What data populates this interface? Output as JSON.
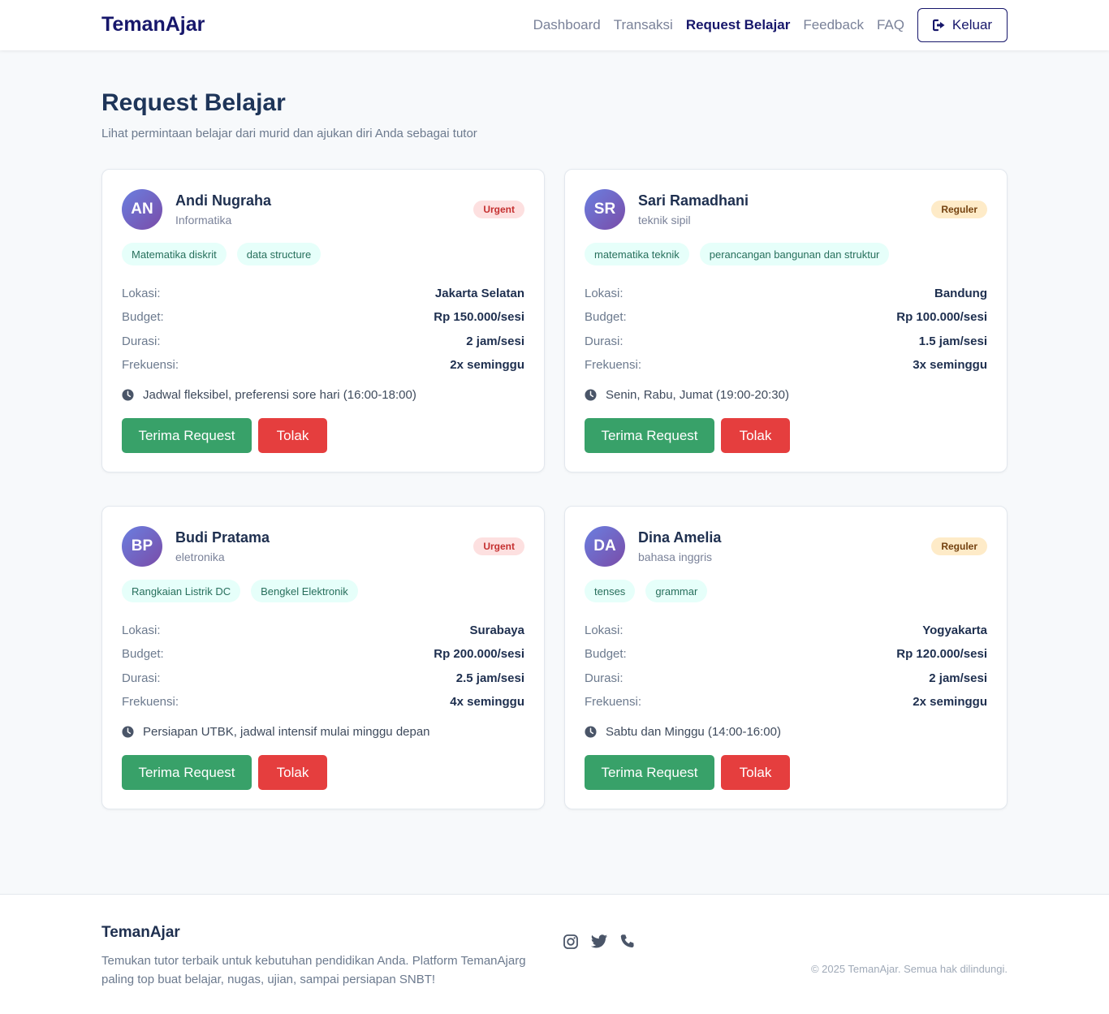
{
  "nav": {
    "brand": "TemanAjar",
    "links": [
      "Dashboard",
      "Transaksi",
      "Request Belajar",
      "Feedback",
      "FAQ"
    ],
    "logout": "Keluar"
  },
  "header": {
    "title": "Request Belajar",
    "subtitle": "Lihat permintaan belajar dari murid dan ajukan diri Anda sebagai tutor"
  },
  "labels": {
    "lokasi": "Lokasi:",
    "budget": "Budget:",
    "durasi": "Durasi:",
    "frekuensi": "Frekuensi:",
    "accept": "Terima Request",
    "reject": "Tolak"
  },
  "requests": [
    {
      "initials": "AN",
      "name": "Andi Nugraha",
      "major": "Informatika",
      "priority": "Urgent",
      "tags": [
        "Matematika diskrit",
        "data structure"
      ],
      "lokasi": "Jakarta Selatan",
      "budget": "Rp 150.000/sesi",
      "durasi": "2 jam/sesi",
      "frekuensi": "2x seminggu",
      "note": "Jadwal fleksibel, preferensi sore hari (16:00-18:00)"
    },
    {
      "initials": "SR",
      "name": "Sari Ramadhani",
      "major": "teknik sipil",
      "priority": "Reguler",
      "tags": [
        "matematika teknik",
        "perancangan bangunan dan struktur"
      ],
      "lokasi": "Bandung",
      "budget": "Rp 100.000/sesi",
      "durasi": "1.5 jam/sesi",
      "frekuensi": "3x seminggu",
      "note": "Senin, Rabu, Jumat (19:00-20:30)"
    },
    {
      "initials": "BP",
      "name": "Budi Pratama",
      "major": "eletronika",
      "priority": "Urgent",
      "tags": [
        "Rangkaian Listrik DC",
        "Bengkel Elektronik"
      ],
      "lokasi": "Surabaya",
      "budget": "Rp 200.000/sesi",
      "durasi": "2.5 jam/sesi",
      "frekuensi": "4x seminggu",
      "note": "Persiapan UTBK, jadwal intensif mulai minggu depan"
    },
    {
      "initials": "DA",
      "name": "Dina Amelia",
      "major": "bahasa inggris",
      "priority": "Reguler",
      "tags": [
        "tenses",
        "grammar"
      ],
      "lokasi": "Yogyakarta",
      "budget": "Rp 120.000/sesi",
      "durasi": "2 jam/sesi",
      "frekuensi": "2x seminggu",
      "note": "Sabtu dan Minggu (14:00-16:00)"
    }
  ],
  "footer": {
    "brand": "TemanAjar",
    "description": "Temukan tutor terbaik untuk kebutuhan pendidikan Anda. Platform TemanAjarg paling top buat belajar, nugas, ujian, sampai persiapan SNBT!",
    "social_icons": [
      "instagram-icon",
      "twitter-icon",
      "phone-icon"
    ],
    "copyright": "© 2025 TemanAjar. Semua hak dilindungi."
  },
  "colors": {
    "brand": "#17176b",
    "accept": "#38a169",
    "reject": "#e53e3e",
    "urgent_bg": "#fde0e0",
    "reguler_bg": "#feebc8"
  }
}
